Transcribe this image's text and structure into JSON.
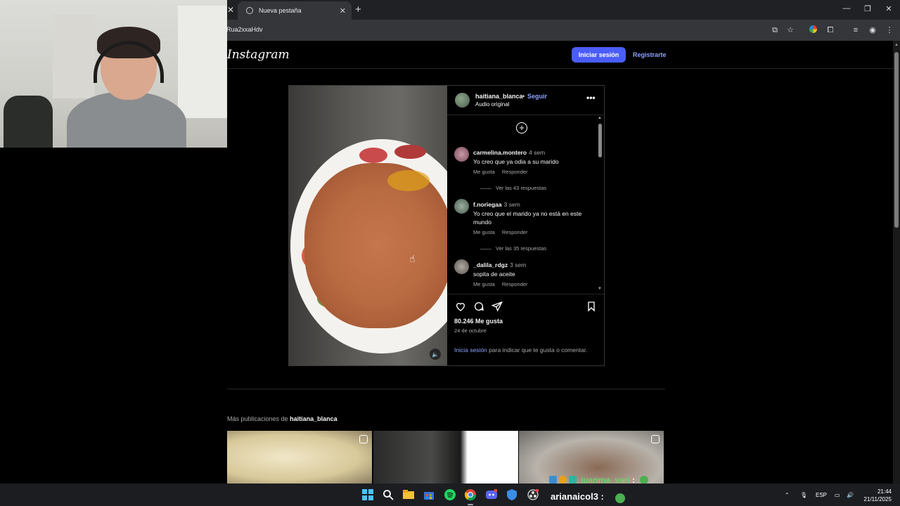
{
  "browser": {
    "tab_title": "Nueva pestaña",
    "url_fragment": "Rua2xxaHdv"
  },
  "instagram": {
    "logo": "Instagram",
    "login_button": "Iniciar sesión",
    "register_link": "Registrarte"
  },
  "post": {
    "username": "haitiana_blanca",
    "separator": "•",
    "follow_label": "Seguir",
    "audio_label": "Audio original",
    "likes": "80.246 Me gusta",
    "date": "24 de octubre",
    "login_link": "Inicia sesión",
    "login_rest": "para indicar que te gusta o comentar."
  },
  "comments": [
    {
      "user": "carmelina.montero",
      "time": "4 sem",
      "text": "Yo creo que ya odia a su marido",
      "like": "Me gusta",
      "reply": "Responder",
      "replies": "Ver las 43 respuestas"
    },
    {
      "user": "f.noriegaa",
      "time": "3 sem",
      "text": "Yo creo que el marido ya no está en este mundo",
      "like": "Me gusta",
      "reply": "Responder",
      "replies": "Ver las 35 respuestas"
    },
    {
      "user": "_dalila_rdgz",
      "time": "3 sem",
      "text": "sopita de aceite",
      "like": "Me gusta",
      "reply": "Responder"
    }
  ],
  "more_posts": {
    "prefix": "Más publicaciones de",
    "user": "haitiana_blanca"
  },
  "stream_chat": {
    "user1": "juanma_vari",
    "colon": ":",
    "user2": "arianaicol3 :"
  },
  "taskbar": {
    "lang": "ESP",
    "time": "21:44",
    "date": "21/11/2025"
  },
  "colors": {
    "accent": "#4a5df9",
    "link": "#8ea2ff",
    "chat_name": "#6ed36b"
  }
}
